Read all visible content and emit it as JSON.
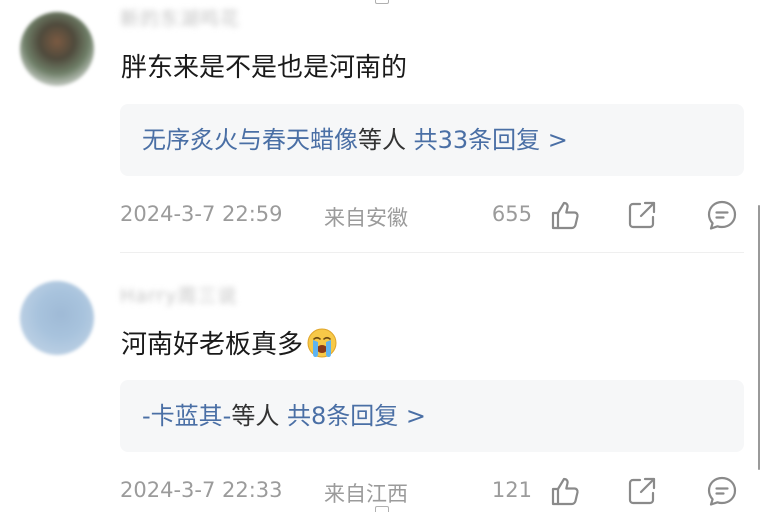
{
  "comments": [
    {
      "username": "新的东湖鸣花",
      "content": "胖东来是不是也是河南的",
      "emoji": "",
      "reply_summary": {
        "names": "无序炙火与春天蜡像",
        "middle": "等人",
        "count_text": "共33条回复 >"
      },
      "timestamp": "2024-3-7 22:59",
      "location": "来自安徽",
      "likes": "655"
    },
    {
      "username": "Harry周三说",
      "content": "河南好老板真多",
      "emoji": "crying-face-emoji",
      "reply_summary": {
        "names": "-卡蓝其-",
        "middle": "等人",
        "count_text": "共8条回复 >"
      },
      "timestamp": "2024-3-7 22:33",
      "location": "来自江西",
      "likes": "121"
    }
  ],
  "icons": {
    "like": "thumbs-up-icon",
    "share": "share-icon",
    "reply": "comment-icon"
  },
  "colors": {
    "link_blue": "#4a6fa5",
    "meta_gray": "#9b9b9b",
    "reply_bg": "#f6f7f8",
    "text_dark": "#1a1a1a"
  }
}
